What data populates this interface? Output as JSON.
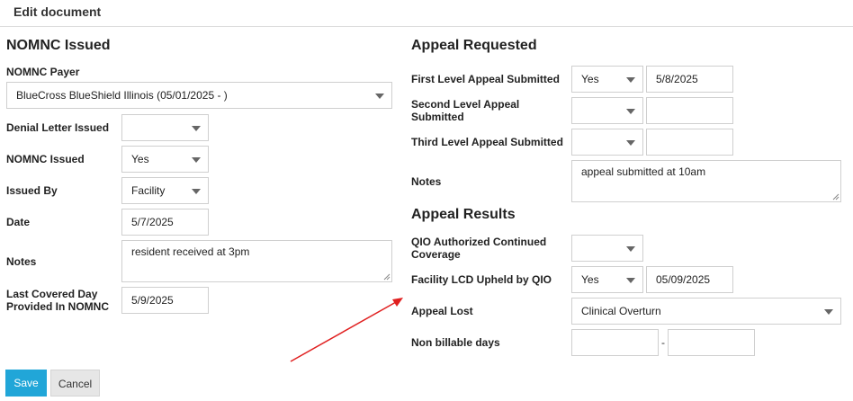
{
  "header": {
    "title": "Edit document"
  },
  "left": {
    "section_title": "NOMNC Issued",
    "payer_label": "NOMNC Payer",
    "payer_value": "BlueCross BlueShield Illinois (05/01/2025 - )",
    "denial_letter_label": "Denial Letter Issued",
    "denial_letter_value": "",
    "nomnc_issued_label": "NOMNC Issued",
    "nomnc_issued_value": "Yes",
    "issued_by_label": "Issued By",
    "issued_by_value": "Facility",
    "date_label": "Date",
    "date_value": "5/7/2025",
    "notes_label": "Notes",
    "notes_value": "resident received at 3pm",
    "last_covered_label_1": "Last Covered Day",
    "last_covered_label_2": "Provided In NOMNC",
    "last_covered_value": "5/9/2025"
  },
  "appeal_requested": {
    "section_title": "Appeal Requested",
    "first_label": "First Level Appeal Submitted",
    "first_select": "Yes",
    "first_date": "5/8/2025",
    "second_label_1": "Second Level Appeal",
    "second_label_2": "Submitted",
    "second_select": "",
    "second_date": "",
    "third_label": "Third Level Appeal Submitted",
    "third_select": "",
    "third_date": "",
    "notes_label": "Notes",
    "notes_value": "appeal submitted at 10am"
  },
  "appeal_results": {
    "section_title": "Appeal Results",
    "qio_label_1": "QIO Authorized Continued",
    "qio_label_2": "Coverage",
    "qio_select": "",
    "lcd_label": "Facility LCD Upheld by QIO",
    "lcd_select": "Yes",
    "lcd_date": "05/09/2025",
    "lost_label": "Appeal Lost",
    "lost_value": "Clinical Overturn",
    "nonbillable_label": "Non billable days",
    "nonbillable_from": "",
    "nonbillable_separator": "-",
    "nonbillable_to": ""
  },
  "actions": {
    "save_label": "Save",
    "cancel_label": "Cancel"
  },
  "colors": {
    "save_button": "#21a6d8",
    "annotation_arrow": "#e02020"
  }
}
